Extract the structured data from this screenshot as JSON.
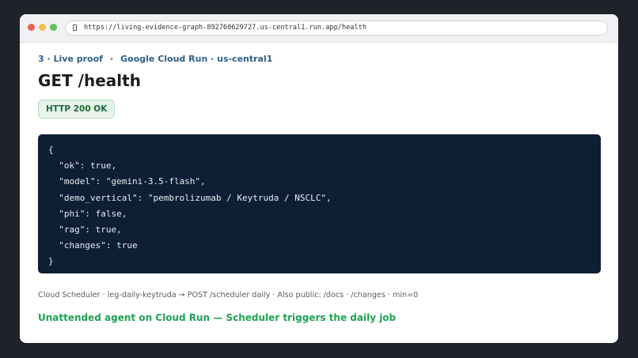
{
  "browser": {
    "url": "https://living-evidence-graph-892760629727.us-central1.run.app/health"
  },
  "breadcrumb": {
    "step": "3 · Live proof",
    "separator": "·",
    "context": "Google Cloud Run · us-central1"
  },
  "page": {
    "title": "GET /health",
    "status_badge": "HTTP 200 OK"
  },
  "response_body": "{\n  \"ok\": true,\n  \"model\": \"gemini-3.5-flash\",\n  \"demo_vertical\": \"pembrolizumab / Keytruda / NSCLC\",\n  \"phi\": false,\n  \"rag\": true,\n  \"changes\": true\n}",
  "footnote": "Cloud Scheduler · leg-daily-keytruda → POST /scheduler daily  ·  Also public: /docs · /changes  ·  min=0",
  "tagline": "Unattended agent on Cloud Run — Scheduler triggers the daily job",
  "colors": {
    "accent_blue": "#2d5f88",
    "success_green": "#1fa351",
    "code_background": "#0d1e35"
  }
}
